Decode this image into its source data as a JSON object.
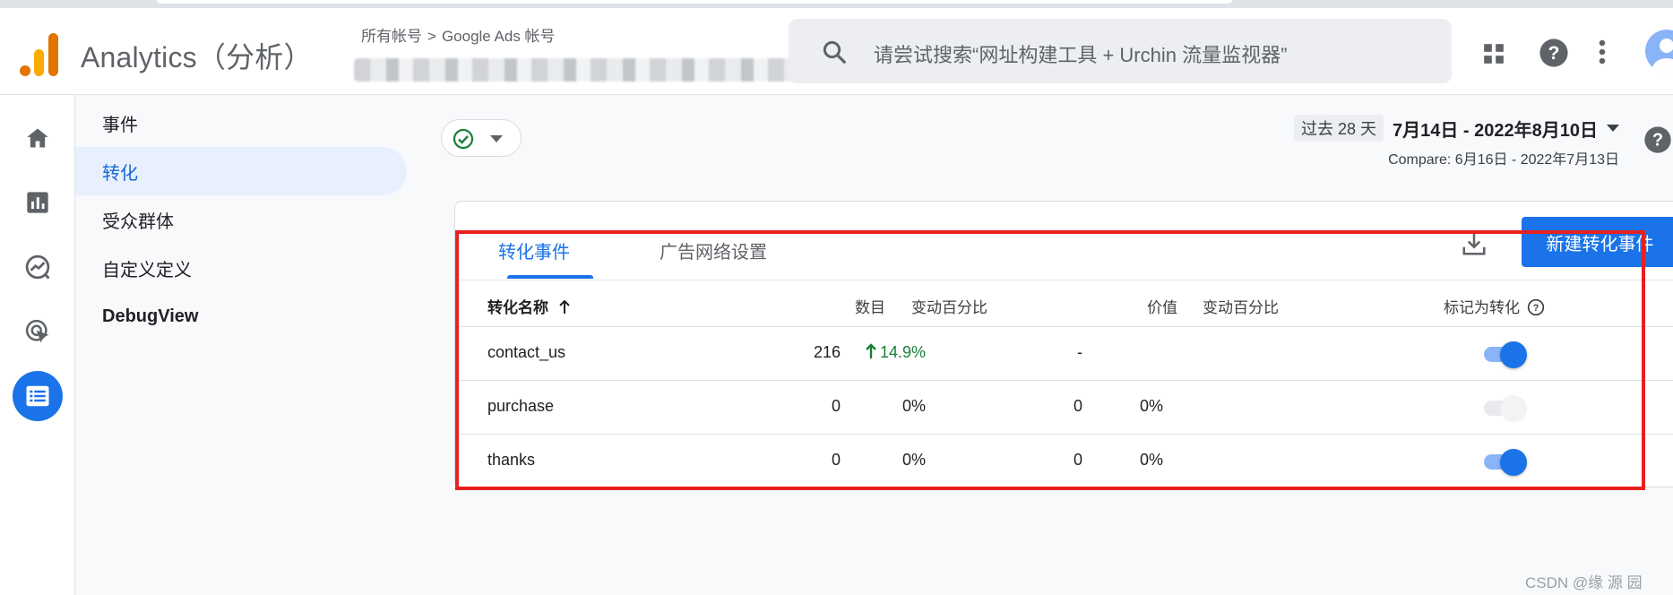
{
  "header": {
    "brand": "Analytics（分析）",
    "breadcrumb_root": "所有帐号",
    "breadcrumb_sep": ">",
    "breadcrumb_account": "Google Ads 帐号",
    "search_placeholder": "请尝试搜索“网址构建工具 + Urchin 流量监视器”"
  },
  "nav": {
    "items": [
      {
        "label": "事件"
      },
      {
        "label": "转化"
      },
      {
        "label": "受众群体"
      },
      {
        "label": "自定义定义"
      },
      {
        "label": "DebugView"
      }
    ]
  },
  "date": {
    "preset": "过去 28 天",
    "range": "7月14日 - 2022年8月10日",
    "compare": "Compare: 6月16日 - 2022年7月13日"
  },
  "tabs": [
    {
      "label": "转化事件"
    },
    {
      "label": "广告网络设置"
    }
  ],
  "new_button": "新建转化事件",
  "table": {
    "headers": {
      "name": "转化名称",
      "count": "数目",
      "count_change": "变动百分比",
      "value": "价值",
      "value_change": "变动百分比",
      "mark": "标记为转化"
    },
    "rows": [
      {
        "name": "contact_us",
        "count": "216",
        "count_change": "14.9%",
        "value": "-",
        "value_change": "",
        "marked": true
      },
      {
        "name": "purchase",
        "count": "0",
        "count_change": "0%",
        "value": "0",
        "value_change": "0%",
        "marked": false
      },
      {
        "name": "thanks",
        "count": "0",
        "count_change": "0%",
        "value": "0",
        "value_change": "0%",
        "marked": true
      }
    ]
  },
  "watermark": "CSDN @缘 源 园",
  "colors": {
    "accent": "#1a73e8",
    "positive": "#188038",
    "highlight": "#e8201e"
  }
}
